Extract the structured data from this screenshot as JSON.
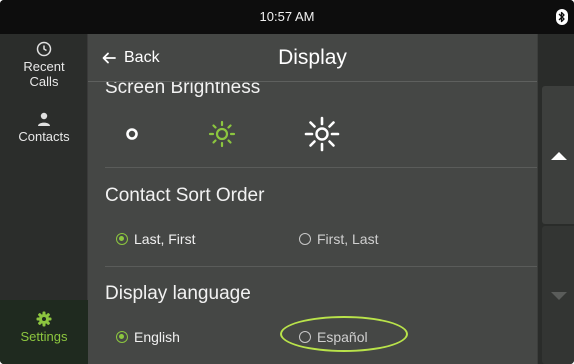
{
  "status_bar": {
    "time": "10:57 AM",
    "bluetooth_icon": "bluetooth-icon"
  },
  "sidebar": {
    "items": [
      {
        "label": "Recent Calls",
        "icon": "clock-icon"
      },
      {
        "label": "Contacts",
        "icon": "person-icon"
      },
      {
        "label": "Settings",
        "icon": "gear-icon",
        "active": true
      }
    ]
  },
  "header": {
    "back_label": "Back",
    "title": "Display"
  },
  "sections": {
    "brightness": {
      "title": "Screen Brightness",
      "options": [
        "brightness-low-icon",
        "brightness-medium-icon",
        "brightness-high-icon"
      ],
      "selected": "brightness-medium-icon"
    },
    "sort_order": {
      "title": "Contact Sort Order",
      "options": [
        {
          "label": "Last, First",
          "selected": true
        },
        {
          "label": "First, Last",
          "selected": false
        }
      ]
    },
    "language": {
      "title": "Display language",
      "options": [
        {
          "label": "English",
          "selected": true
        },
        {
          "label": "Español",
          "selected": false
        }
      ]
    }
  },
  "colors": {
    "accent": "#8cc63f",
    "highlight_ring": "#b9e34a",
    "panel": "#454745"
  }
}
